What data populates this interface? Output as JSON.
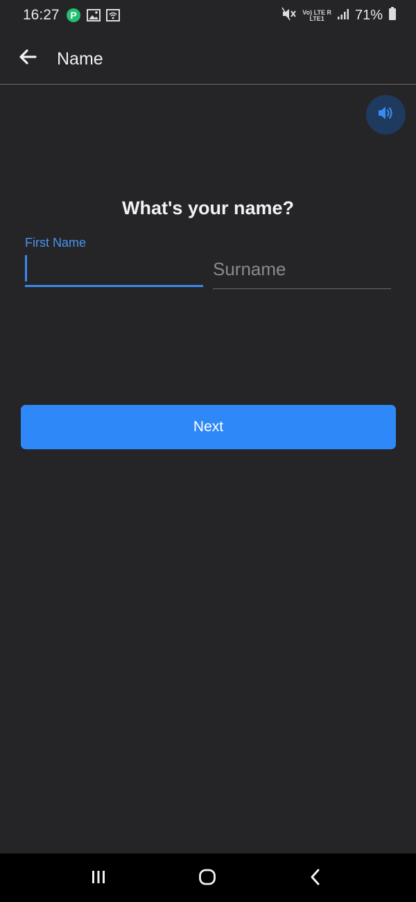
{
  "status_bar": {
    "time": "16:27",
    "battery_percent": "71%",
    "network_line1": "Vo) LTE R",
    "network_line2": "LTE1",
    "left_icons": [
      "app-notification-icon",
      "image-icon",
      "wifi-calling-icon"
    ],
    "right_icons": [
      "mute-icon",
      "signal-icon",
      "battery-icon"
    ]
  },
  "app_bar": {
    "title": "Name",
    "back_icon": "arrow-left-icon"
  },
  "speaker": {
    "icon": "speaker-icon",
    "bg_color": "#1e3a5f",
    "icon_color": "#3b8af0"
  },
  "form": {
    "question": "What's your name?",
    "first_name": {
      "label": "First Name",
      "value": ""
    },
    "surname": {
      "placeholder": "Surname",
      "value": ""
    }
  },
  "next_button": {
    "label": "Next",
    "color": "#2f88f7"
  },
  "nav_bar": {
    "icons": [
      "recent-apps-icon",
      "home-icon",
      "back-icon"
    ]
  },
  "colors": {
    "background": "#252527",
    "accent": "#3b8af0"
  }
}
